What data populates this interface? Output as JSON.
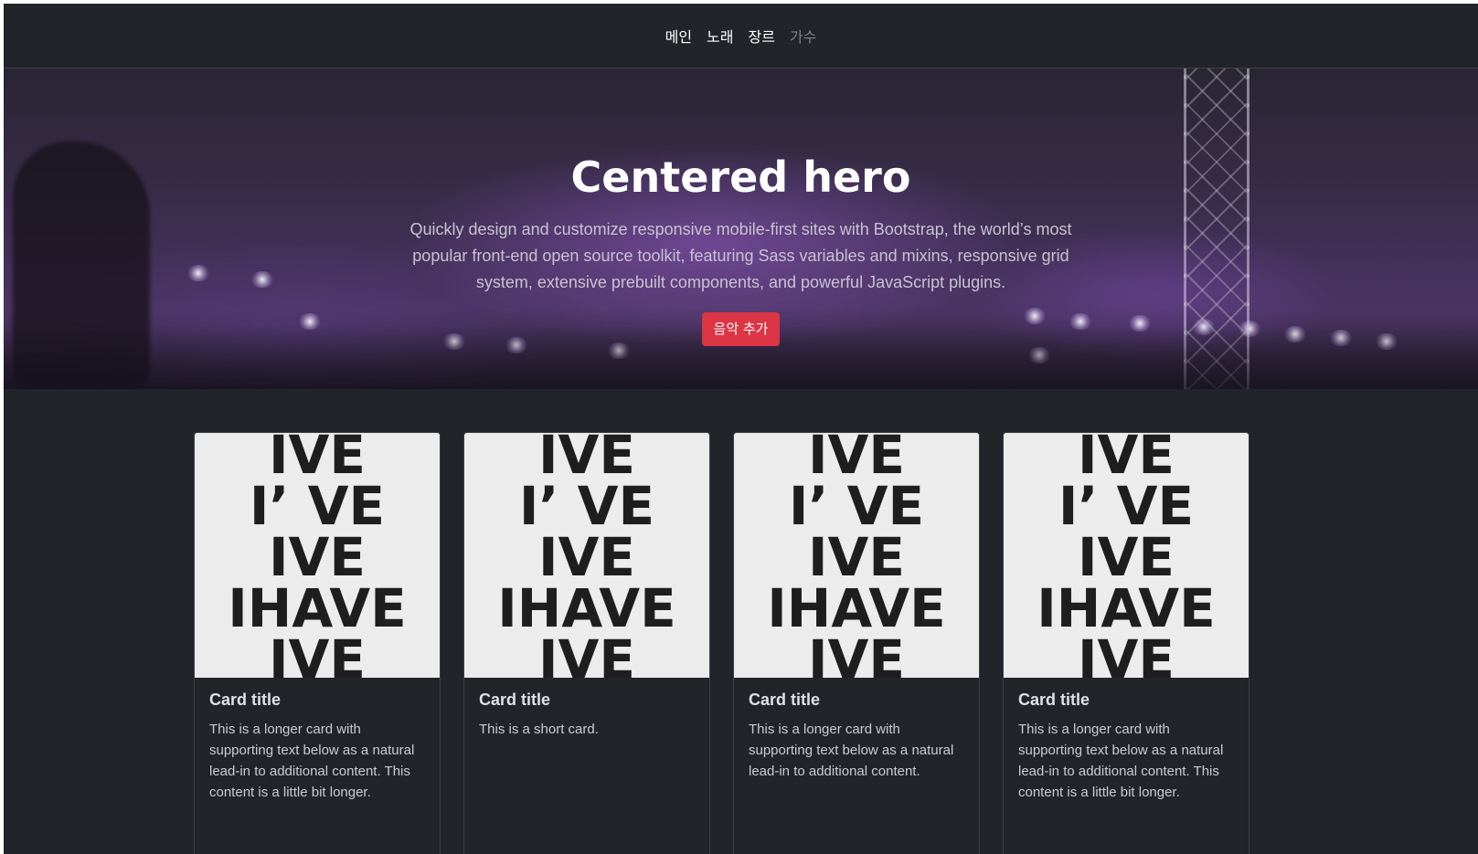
{
  "nav": {
    "items": [
      {
        "label": "메인"
      },
      {
        "label": "노래"
      },
      {
        "label": "장르"
      },
      {
        "label": "가수"
      }
    ]
  },
  "hero": {
    "title": "Centered hero",
    "lead": "Quickly design and customize responsive mobile-first sites with Bootstrap, the world’s most popular front-end open source toolkit, featuring Sass variables and mixins, responsive grid system, extensive prebuilt components, and powerful JavaScript plugins.",
    "button_label": "음악 추가"
  },
  "cards": [
    {
      "image_text": [
        "IVE",
        "I’ VE",
        "IVE",
        "IHAVE",
        "IVE"
      ],
      "title": "Card title",
      "text": "This is a longer card with supporting text below as a natural lead-in to additional content. This content is a little bit longer."
    },
    {
      "image_text": [
        "IVE",
        "I’ VE",
        "IVE",
        "IHAVE",
        "IVE"
      ],
      "title": "Card title",
      "text": "This is a short card."
    },
    {
      "image_text": [
        "IVE",
        "I’ VE",
        "IVE",
        "IHAVE",
        "IVE"
      ],
      "title": "Card title",
      "text": "This is a longer card with supporting text below as a natural lead-in to additional content."
    },
    {
      "image_text": [
        "IVE",
        "I’ VE",
        "IVE",
        "IHAVE",
        "IVE"
      ],
      "title": "Card title",
      "text": "This is a longer card with supporting text below as a natural lead-in to additional content. This content is a little bit longer."
    }
  ],
  "colors": {
    "background": "#212529",
    "accent_button": "#dc3545",
    "hero_purple": "#4a3462"
  }
}
